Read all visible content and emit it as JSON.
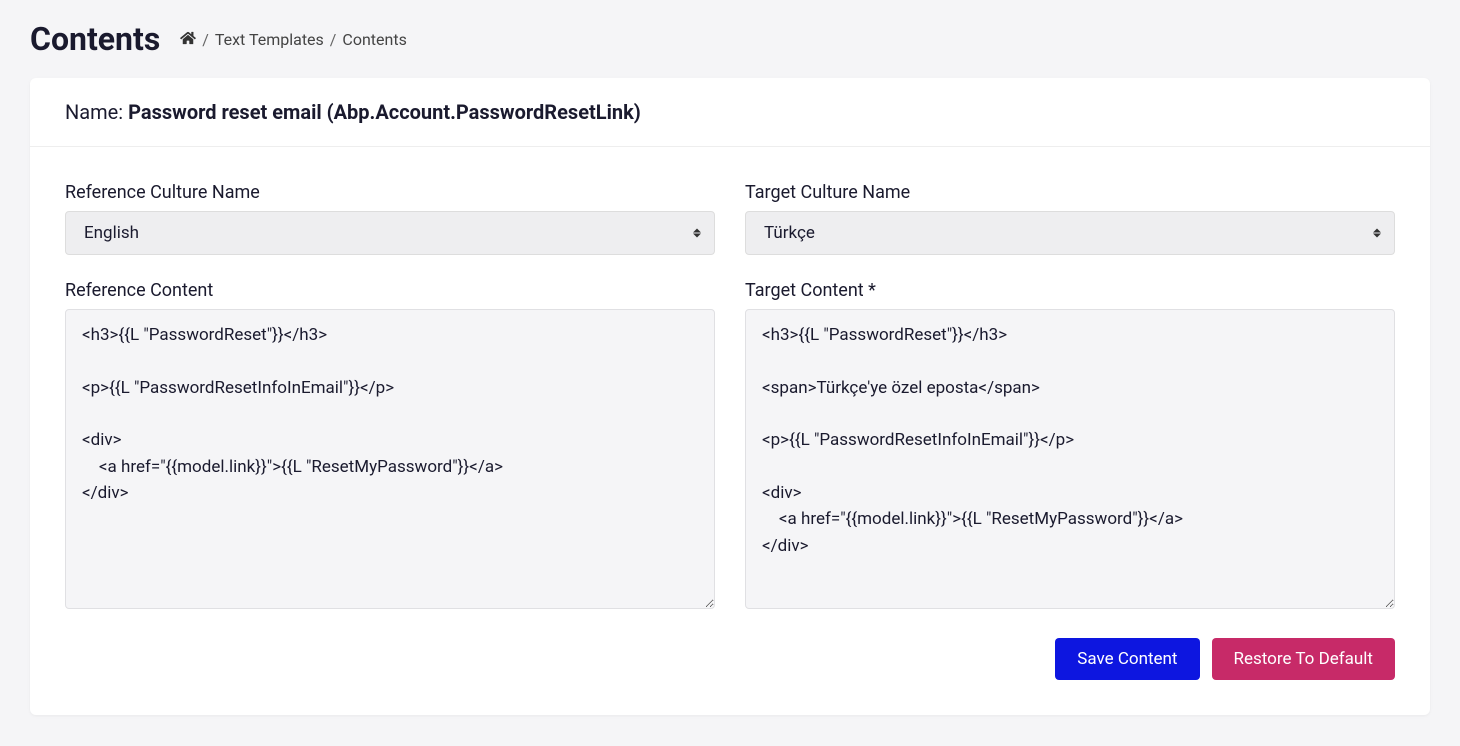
{
  "header": {
    "title": "Contents",
    "breadcrumb": {
      "items": [
        "Text Templates",
        "Contents"
      ]
    }
  },
  "card": {
    "name_label": "Name:",
    "name_value": "Password reset email (Abp.Account.PasswordResetLink)"
  },
  "form": {
    "reference_culture_label": "Reference Culture Name",
    "reference_culture_value": "English",
    "target_culture_label": "Target Culture Name",
    "target_culture_value": "Türkçe",
    "reference_content_label": "Reference Content",
    "reference_content_value": "<h3>{{L \"PasswordReset\"}}</h3>\n\n<p>{{L \"PasswordResetInfoInEmail\"}}</p>\n\n<div>\n    <a href=\"{{model.link}}\">{{L \"ResetMyPassword\"}}</a>\n</div>",
    "target_content_label": "Target Content *",
    "target_content_value": "<h3>{{L \"PasswordReset\"}}</h3>\n\n<span>Türkçe'ye özel eposta</span>\n\n<p>{{L \"PasswordResetInfoInEmail\"}}</p>\n\n<div>\n    <a href=\"{{model.link}}\">{{L \"ResetMyPassword\"}}</a>\n</div>"
  },
  "buttons": {
    "save": "Save Content",
    "restore": "Restore To Default"
  }
}
